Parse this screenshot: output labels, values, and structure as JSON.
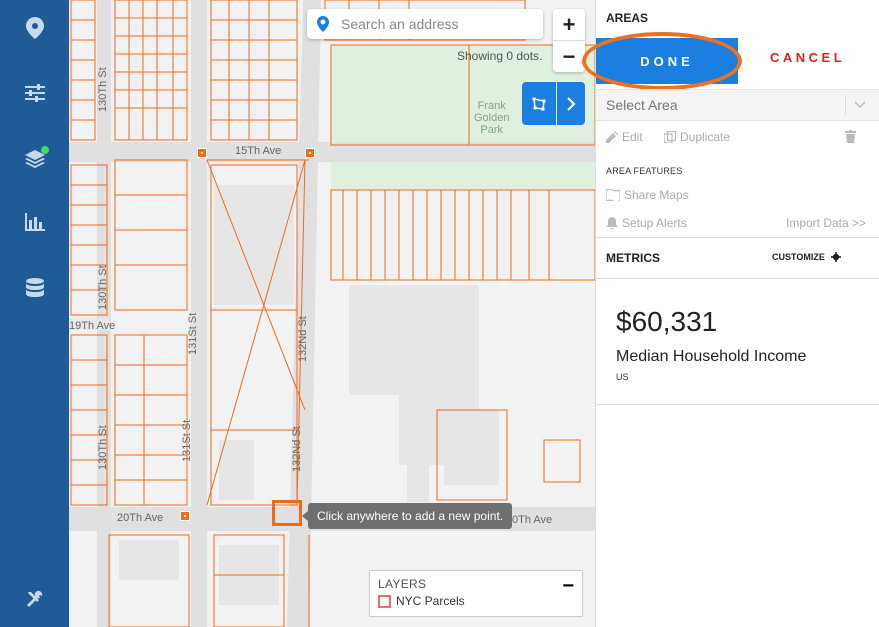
{
  "nav": {
    "items": [
      {
        "name": "location-pin-icon"
      },
      {
        "name": "sliders-icon"
      },
      {
        "name": "layers-icon"
      },
      {
        "name": "bar-chart-icon"
      },
      {
        "name": "database-icon"
      },
      {
        "name": "tools-icon"
      }
    ],
    "active_indicator_color": "#39e05b"
  },
  "map": {
    "search": {
      "placeholder": "Search an address"
    },
    "zoom_in": "+",
    "zoom_out": "−",
    "dots_status": "Showing 0 dots.",
    "streets": {
      "s15th": "15Th Ave",
      "s20th": "20Th Ave",
      "s19th_left": "19Th Ave",
      "s20th_right": "0Th Ave",
      "s130th_top": "130Th St",
      "s130th_mid": "130Th St",
      "s130th_bottom": "130Th St",
      "s131st_mid": "131St St",
      "s131st_bottom": "131St St",
      "s132nd_mid": "132Nd St",
      "s132nd_bottom": "132Nd St"
    },
    "park_label": [
      "Frank",
      "Golden",
      "Park"
    ],
    "tooltip": "Click anywhere to add a new point.",
    "layers": {
      "title": "LAYERS",
      "items": [
        "NYC Parcels"
      ],
      "collapse": "−"
    },
    "colors": {
      "parcel": "#f06a1a",
      "park": "#dff0de",
      "road": "#e0e0e0",
      "accent": "#1a7fe0"
    }
  },
  "panel": {
    "title": "AREAS",
    "done": "DONE",
    "cancel": "CANCEL",
    "select_area": "Select Area",
    "actions": {
      "edit": "Edit",
      "duplicate": "Duplicate"
    },
    "features_title": "AREA FEATURES",
    "share_maps": "Share Maps",
    "setup_alerts": "Setup Alerts",
    "import_data": "Import Data >>",
    "metrics_title": "METRICS",
    "customize": "CUSTOMIZE",
    "metric": {
      "value": "$60,331",
      "label": "Median Household Income",
      "sub": "US"
    },
    "colors": {
      "done_bg": "#1a7fe0",
      "cancel": "#e32020",
      "highlight_ring": "#f0701e"
    }
  }
}
